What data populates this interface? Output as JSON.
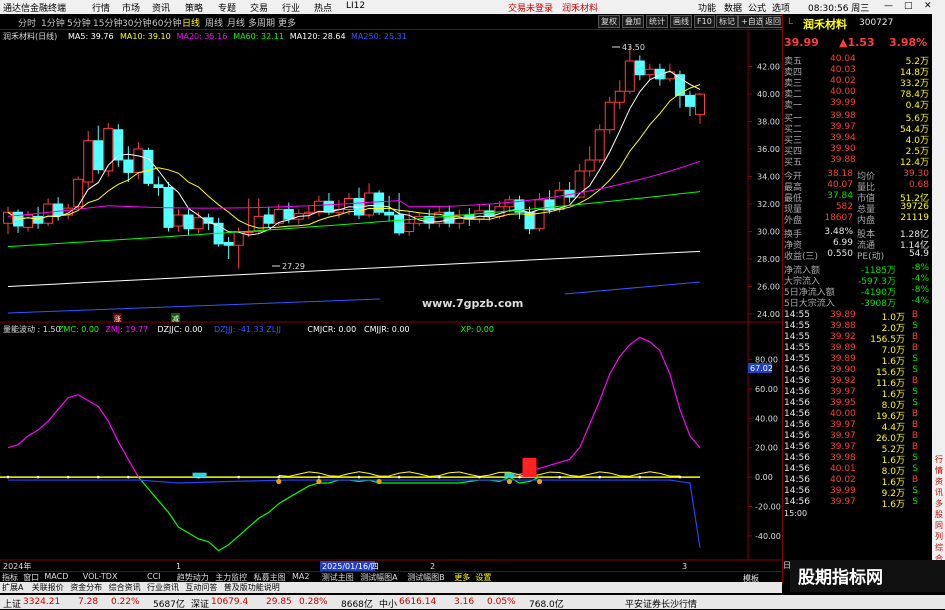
{
  "titlebar": {
    "app": "通达信金融终端",
    "menu": [
      "行情",
      "市场",
      "资讯",
      "策略",
      "专题",
      "交易",
      "行业",
      "热点"
    ],
    "ip": "LI12",
    "notice1": "交易未登录",
    "notice2": "润禾材料",
    "right": [
      "功能",
      "数据",
      "公式",
      "选项"
    ],
    "clock": "08:30:56 周三"
  },
  "tabbar": {
    "periods": [
      "分时",
      "1分钟",
      "5分钟",
      "15分钟",
      "30分钟",
      "60分钟",
      "日线",
      "周线",
      "月线",
      "多周期",
      "更多"
    ],
    "active": "日线",
    "buttons": [
      "复权",
      "叠加",
      "统计",
      "画线",
      "F10",
      "标记",
      "+自选",
      "返回"
    ]
  },
  "chart": {
    "title": "润禾材料(日线)",
    "ma": [
      {
        "label": "MA5: 39.76",
        "color": "#ffffff"
      },
      {
        "label": "MA10: 39.10",
        "color": "#ffff00"
      },
      {
        "label": "MA20: 35.16",
        "color": "#ff00ff"
      },
      {
        "label": "MA60: 32.11",
        "color": "#00ff00"
      },
      {
        "label": "MA120: 28.64",
        "color": "#ffffff"
      },
      {
        "label": "MA250: 25.31",
        "color": "#3355ff"
      }
    ],
    "high_label": "43.50",
    "low_label": "27.29",
    "yticks": [
      "42.00",
      "40.00",
      "38.00",
      "36.00",
      "34.00",
      "32.00",
      "30.00",
      "28.00",
      "26.00",
      "24.00"
    ],
    "watermark": "www.7gpzb.com",
    "marker_red": "涨",
    "marker_green": "减"
  },
  "indicator": {
    "name": "量能波动 : 1.50",
    "fields": [
      {
        "label": "ZMC: 0.00",
        "color": "#00ff00"
      },
      {
        "label": "ZMJ: 19.77",
        "color": "#ff00ff"
      },
      {
        "label": "DZJJC: 0.00",
        "color": "#ffffff"
      },
      {
        "label": "DZJJJ: -41.33  ZLJJ",
        "color": "#3355ff"
      },
      {
        "label": "CMJCR: 0.00",
        "color": "#ffffff"
      },
      {
        "label": "CMJJR: 0.00",
        "color": "#ffffff"
      },
      {
        "label": "XP: 0.00",
        "color": "#00ff00"
      }
    ],
    "yticks": [
      "80.00",
      "60.00",
      "40.00",
      "20.00",
      "0.00",
      "-20.00",
      "-40.00"
    ],
    "cur_value": "67.02"
  },
  "timeaxis": {
    "start": "2024年",
    "mark1": "1",
    "date": "2025/01/16/四",
    "mark2": "2",
    "mark3": "3"
  },
  "indtabs": [
    "指标",
    "窗口",
    "MACD",
    "VOL-TDX",
    "CCI",
    "趋势动力",
    "主力监控",
    "私募主图",
    "MA2",
    "测试主图",
    "测试幅图A",
    "测试幅图B",
    "更多",
    "设置"
  ],
  "bottomtabs": [
    "扩展A",
    "关联报价",
    "资金分布",
    "综合资讯",
    "行业资讯",
    "互动问答",
    "普及版功能说明"
  ],
  "quote": {
    "name": "润禾材料",
    "code": "300727",
    "price": "39.99",
    "change": "▲1.53",
    "pct": "3.98%",
    "sells": [
      {
        "label": "卖五",
        "price": "40.04",
        "vol": "5.2万"
      },
      {
        "label": "卖四",
        "price": "40.03",
        "vol": "14.8万"
      },
      {
        "label": "卖三",
        "price": "40.02",
        "vol": "33.2万"
      },
      {
        "label": "卖二",
        "price": "40.00",
        "vol": "78.4万"
      },
      {
        "label": "卖一",
        "price": "39.99",
        "vol": "0.4万"
      }
    ],
    "buys": [
      {
        "label": "买一",
        "price": "39.98",
        "vol": "5.6万"
      },
      {
        "label": "买二",
        "price": "39.97",
        "vol": "54.4万"
      },
      {
        "label": "买三",
        "price": "39.94",
        "vol": "4.0万"
      },
      {
        "label": "买四",
        "price": "39.90",
        "vol": "2.5万"
      },
      {
        "label": "买五",
        "price": "39.88",
        "vol": "12.4万"
      }
    ],
    "stats": [
      {
        "l1": "今开",
        "v1": "38.18",
        "l2": "均价",
        "v2": "39.30"
      },
      {
        "l1": "最高",
        "v1": "40.07",
        "l2": "量比",
        "v2": "0.68"
      },
      {
        "l1": "最低",
        "v1": "37.84",
        "l2": "市值",
        "v2": "51.2亿"
      },
      {
        "l1": "现量",
        "v1": "582",
        "l2": "总量",
        "v2": "39726"
      },
      {
        "l1": "外盘",
        "v1": "18607",
        "l2": "内盘",
        "v2": "21119"
      }
    ],
    "stats2": [
      {
        "l1": "换手",
        "v1": "3.48%",
        "l2": "股本",
        "v2": "1.28亿"
      },
      {
        "l1": "净资",
        "v1": "6.99",
        "l2": "流通",
        "v2": "1.14亿"
      },
      {
        "l1": "收益(三)",
        "v1": "0.550",
        "l2": "PE(动)",
        "v2": "54.9"
      }
    ],
    "flows": [
      {
        "label": "净流入额",
        "value": "-1185万",
        "pct": "-8%"
      },
      {
        "label": "大宗流入",
        "value": "-597.3万",
        "pct": "-4%"
      },
      {
        "label": "5日净流入额",
        "value": "-4190万",
        "pct": "-8%"
      },
      {
        "label": "5日大宗流入",
        "value": "-3908万",
        "pct": "-4%"
      }
    ],
    "ticks": [
      {
        "t": "14:55",
        "p": "39.89",
        "v": "1.0万",
        "s": "B"
      },
      {
        "t": "14:55",
        "p": "39.88",
        "v": "2.0万",
        "s": "S"
      },
      {
        "t": "14:55",
        "p": "39.92",
        "v": "156.5万",
        "s": "B"
      },
      {
        "t": "14:55",
        "p": "39.89",
        "v": "7.0万",
        "s": "B"
      },
      {
        "t": "14:55",
        "p": "39.89",
        "v": "1.6万",
        "s": "S"
      },
      {
        "t": "14:56",
        "p": "39.90",
        "v": "15.6万",
        "s": "S"
      },
      {
        "t": "14:56",
        "p": "39.92",
        "v": "11.6万",
        "s": "B"
      },
      {
        "t": "14:56",
        "p": "39.97",
        "v": "1.6万",
        "s": "S"
      },
      {
        "t": "14:56",
        "p": "39.95",
        "v": "8.0万",
        "s": "S"
      },
      {
        "t": "14:56",
        "p": "40.00",
        "v": "19.6万",
        "s": "B"
      },
      {
        "t": "14:56",
        "p": "39.97",
        "v": "4.4万",
        "s": "B"
      },
      {
        "t": "14:56",
        "p": "39.97",
        "v": "26.0万",
        "s": "B"
      },
      {
        "t": "14:56",
        "p": "39.97",
        "v": "5.2万",
        "s": "B"
      },
      {
        "t": "14:56",
        "p": "39.98",
        "v": "1.6万",
        "s": "S"
      },
      {
        "t": "14:56",
        "p": "40.01",
        "v": "8.0万",
        "s": "S"
      },
      {
        "t": "14:56",
        "p": "40.02",
        "v": "1.6万",
        "s": "B"
      },
      {
        "t": "14:56",
        "p": "39.99",
        "v": "9.2万",
        "s": "S"
      },
      {
        "t": "14:56",
        "p": "39.97",
        "v": "1.6万",
        "s": "S"
      }
    ],
    "tabs": [
      "日线",
      "模板",
      "图文F10",
      "筹码"
    ],
    "time_label": "15:00"
  },
  "strip": [
    "行",
    "情",
    "资",
    "讯",
    "多",
    "股",
    "同",
    "列",
    "综",
    "合",
    "排",
    "名"
  ],
  "statusbar": {
    "items": [
      {
        "label": "上证",
        "v": "3324.21",
        "c": "7.28",
        "p": "0.22%",
        "amt": "5687亿"
      },
      {
        "label": "深证",
        "v": "10679.4",
        "c": "29.85",
        "p": "0.28%",
        "amt": "8668亿"
      },
      {
        "label": "中小",
        "v": "6616.14",
        "c": "3.16",
        "p": "0.05%",
        "amt": "768.0亿"
      }
    ],
    "broker": "平安证券长沙行情"
  },
  "watermark_logo": "股期指标网",
  "colors": {
    "up": "#ff3b3b",
    "down": "#00e600",
    "accent": "#ffff00",
    "frame": "#800000"
  }
}
